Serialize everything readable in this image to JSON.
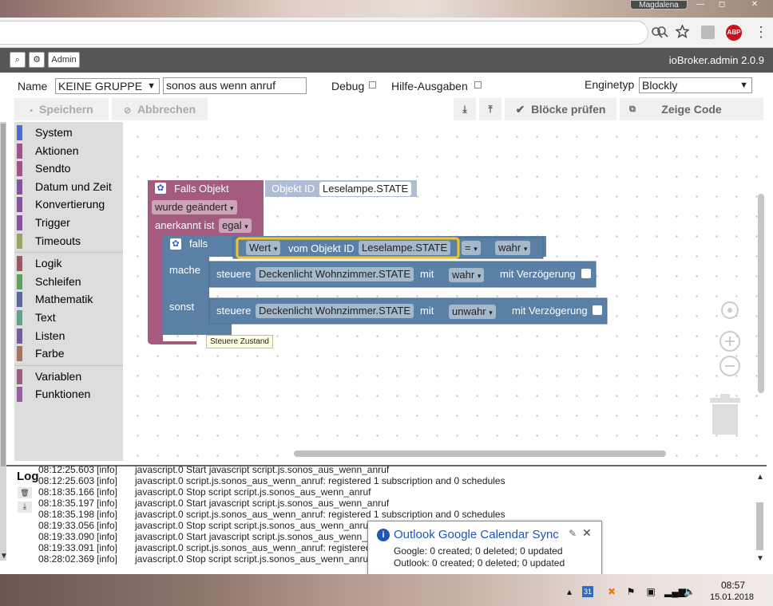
{
  "window": {
    "user": "Magdalena",
    "min": "—",
    "max": "◻",
    "close": "✕"
  },
  "browser": {
    "zoom_icon": "search-icon",
    "star_icon": "star-icon",
    "abp_label": "ABP",
    "menu": "⋮"
  },
  "header": {
    "search_glyph": "⌕",
    "settings_glyph": "⚙",
    "admin_label": "Admin",
    "title": "ioBroker.admin 2.0.9"
  },
  "settings": {
    "name_label": "Name",
    "group": "KEINE GRUPPE",
    "script_name": "sonos aus wenn anruf",
    "debug_label": "Debug",
    "help_label": "Hilfe-Ausgaben",
    "engine_label": "Enginetyp",
    "engine": "Blockly"
  },
  "toolbar": {
    "save": "Speichern",
    "cancel": "Abbrechen",
    "check": "Blöcke prüfen",
    "show_code": "Zeige Code"
  },
  "toolbox": {
    "group1": [
      "System",
      "Aktionen",
      "Sendto",
      "Datum und Zeit",
      "Konvertierung",
      "Trigger",
      "Timeouts"
    ],
    "group2": [
      "Logik",
      "Schleifen",
      "Mathematik",
      "Text",
      "Listen",
      "Farbe"
    ],
    "group3": [
      "Variablen",
      "Funktionen"
    ],
    "colors1": [
      "#4a6cd4",
      "#a54f8c",
      "#a54f8c",
      "#8a4fa8",
      "#8a4fa8",
      "#8a4fa8",
      "#9aa55b"
    ],
    "colors2": [
      "#a5545b",
      "#5ba55b",
      "#5b67a5",
      "#5ba58c",
      "#745ba5",
      "#a5745b"
    ],
    "colors3": [
      "#a55b80",
      "#995ba5"
    ]
  },
  "blocks": {
    "trigger_title": "Falls Objekt",
    "object_label": "Objekt ID",
    "object_id": "Leselampe.STATE",
    "changed": "wurde geändert",
    "ack_label": "anerkannt ist",
    "ack_value": "egal",
    "if_label": "falls",
    "do_label": "mache",
    "else_label": "sonst",
    "value_label": "Wert",
    "of_object_label": "vom Objekt ID",
    "cond_object": "Leselampe.STATE",
    "operator": "=",
    "true_value": "wahr",
    "control_label": "steuere",
    "target_object": "Deckenlicht Wohnzimmer.STATE",
    "with_label": "mit",
    "false_value": "unwahr",
    "delay_label": "mit Verzögerung",
    "tooltip": "Steuere Zustand"
  },
  "log": {
    "title": "Log",
    "lines": [
      [
        "08:12:25.603",
        "[info]",
        "javascript.0 Start javascript script.js.sonos_aus_wenn_anruf"
      ],
      [
        "08:12:25.603",
        "[info]",
        "javascript.0 script.js.sonos_aus_wenn_anruf: registered 1 subscription and 0 schedules"
      ],
      [
        "08:18:35.166",
        "[info]",
        "javascript.0 Stop script script.js.sonos_aus_wenn_anruf"
      ],
      [
        "08:18:35.197",
        "[info]",
        "javascript.0 Start javascript script.js.sonos_aus_wenn_anruf"
      ],
      [
        "08:18:35.198",
        "[info]",
        "javascript.0 script.js.sonos_aus_wenn_anruf: registered 1 subscription and 0 schedules"
      ],
      [
        "08:19:33.056",
        "[info]",
        "javascript.0 Stop script script.js.sonos_aus_wenn_anruf"
      ],
      [
        "08:19:33.090",
        "[info]",
        "javascript.0 Start javascript script.js.sonos_aus_wenn_anruf"
      ],
      [
        "08:19:33.091",
        "[info]",
        "javascript.0 script.js.sonos_aus_wenn_anruf: registered"
      ],
      [
        "08:28:02.369",
        "[info]",
        "javascript.0 Stop script script.js.sonos_aus_wenn_anruf"
      ]
    ]
  },
  "toast": {
    "title": "Outlook Google Calendar Sync",
    "line1": "Google: 0 created; 0 deleted; 0 updated",
    "line2": "Outlook: 0 created; 0 deleted; 0 updated"
  },
  "taskbar": {
    "time": "08:57",
    "date": "15.01.2018"
  }
}
